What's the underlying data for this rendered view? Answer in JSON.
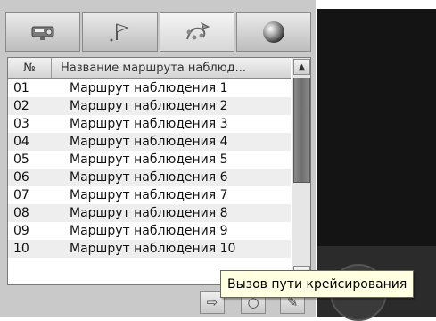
{
  "tabs": [
    {
      "icon": "camera-settings-icon"
    },
    {
      "icon": "flag-icon"
    },
    {
      "icon": "patrol-route-icon"
    },
    {
      "icon": "sphere-icon"
    }
  ],
  "table": {
    "col_num": "№",
    "col_name": "Название маршрута наблюд...",
    "rows": [
      {
        "num": "01",
        "name": "Маршрут наблюдения  1"
      },
      {
        "num": "02",
        "name": "Маршрут наблюдения  2"
      },
      {
        "num": "03",
        "name": "Маршрут наблюдения  3"
      },
      {
        "num": "04",
        "name": "Маршрут наблюдения  4"
      },
      {
        "num": "05",
        "name": "Маршрут наблюдения  5"
      },
      {
        "num": "06",
        "name": "Маршрут наблюдения  6"
      },
      {
        "num": "07",
        "name": "Маршрут наблюдения  7"
      },
      {
        "num": "08",
        "name": "Маршрут наблюдения  8"
      },
      {
        "num": "09",
        "name": "Маршрут наблюдения  9"
      },
      {
        "num": "10",
        "name": "Маршрут наблюдения  10"
      }
    ]
  },
  "toolbar": {
    "call_icon": "⇨",
    "record_icon": "○",
    "edit_icon": "✎"
  },
  "tooltip": "Вызов пути крейсирования"
}
